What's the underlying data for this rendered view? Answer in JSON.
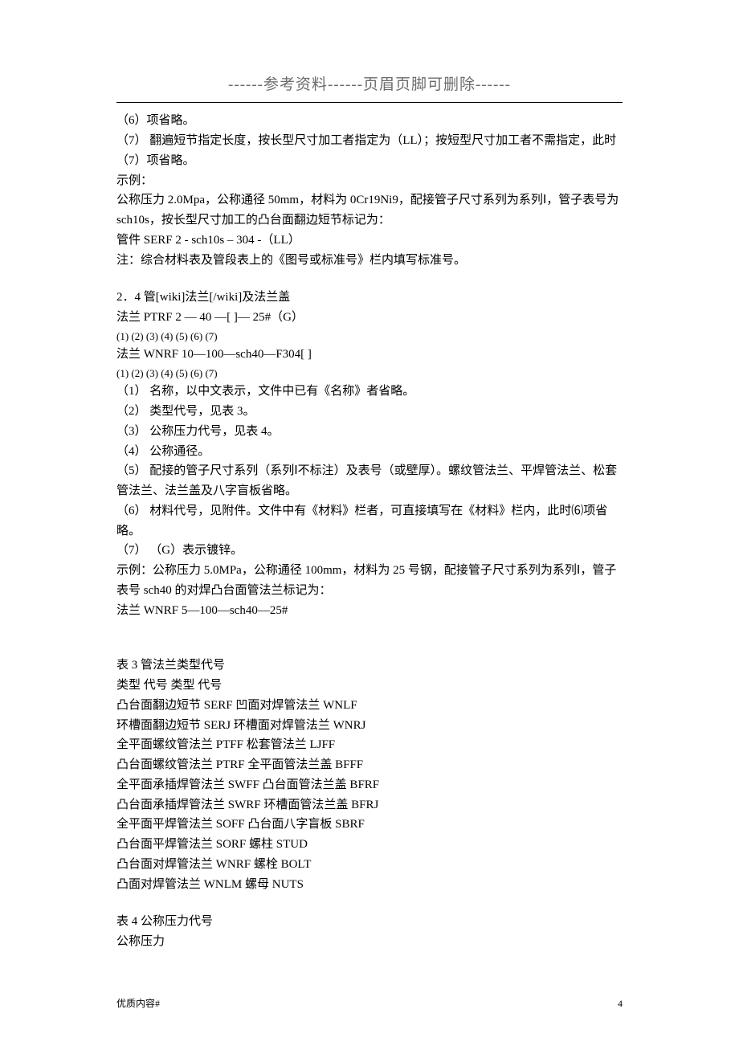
{
  "header": "------参考资料------页眉页脚可删除------",
  "body": {
    "p1": "（6）项省略。",
    "p2": "（7）        翻遍短节指定长度，按长型尺寸加工者指定为（LL）；按短型尺寸加工者不需指定，此时（7）项省略。",
    "p3": "示例：",
    "p4": "公称压力 2.0Mpa，公称通径 50mm，材料为 0Cr19Ni9，配接管子尺寸系列为系列Ⅰ，管子表号为 sch10s，按长型尺寸加工的凸台面翻边短节标记为：",
    "p5": "管件  SERF 2 - sch10s – 304 -（LL）",
    "p6": "注：综合材料表及管段表上的《图号或标准号》栏内填写标准号。",
    "s24_title": "2．4   管[wiki]法兰[/wiki]及法兰盖",
    "s24_l1": "法兰  PTRF  2 — 40 —[   ]— 25#（G）",
    "s24_l2": "(1)     (2)      (3)  (4)      (5)       (6)  (7)",
    "s24_l3": "法兰  WNRF   10—100—sch40—F304[   ]",
    "s24_l4": "(1)     (2)      (3)   (4)      (5)       (6)   (7)",
    "s24_i1": "（1）        名称，以中文表示，文件中已有《名称》者省略。",
    "s24_i2": "（2）        类型代号，见表 3。",
    "s24_i3": "（3）        公称压力代号，见表 4。",
    "s24_i4": "（4）        公称通径。",
    "s24_i5": "（5）        配接的管子尺寸系列（系列Ⅰ不标注）及表号（或壁厚）。螺纹管法兰、平焊管法兰、松套管法兰、法兰盖及八字盲板省略。",
    "s24_i6": "（6）        材料代号，见附件。文件中有《材料》栏者，可直接填写在《材料》栏内，此时⑹项省略。",
    "s24_i7": "（7）       （G）表示镀锌。",
    "s24_ex1": "示例：公称压力 5.0MPa，公称通径 100mm，材料为 25 号钢，配接管子尺寸系列为系列Ⅰ，管子表号 sch40 的对焊凸台面管法兰标记为：",
    "s24_ex2": "法兰 WNRF 5—100—sch40—25#",
    "t3_title": "表 3 管法兰类型代号",
    "t3_head": "类型        代号        类型        代号",
    "t3_r1": "凸台面翻边短节        SERF        凹面对焊管法兰        WNLF",
    "t3_r2": "环槽面翻边短节        SERJ        环槽面对焊管法兰        WNRJ",
    "t3_r3": "全平面螺纹管法兰        PTFF        松套管法兰        LJFF",
    "t3_r4": "凸台面螺纹管法兰        PTRF        全平面管法兰盖        BFFF",
    "t3_r5": "全平面承插焊管法兰        SWFF        凸台面管法兰盖        BFRF",
    "t3_r6": "凸台面承插焊管法兰        SWRF        环槽面管法兰盖        BFRJ",
    "t3_r7": "全平面平焊管法兰        SOFF        凸台面八字盲板        SBRF",
    "t3_r8": "凸台面平焊管法兰        SORF        螺柱        STUD",
    "t3_r9": "凸台面对焊管法兰        WNRF        螺栓        BOLT",
    "t3_r10": "凸面对焊管法兰        WNLM        螺母        NUTS",
    "t4_title": "表 4 公称压力代号",
    "t4_sub": "公称压力"
  },
  "footer": {
    "left": "优质内容#",
    "right": "4"
  }
}
